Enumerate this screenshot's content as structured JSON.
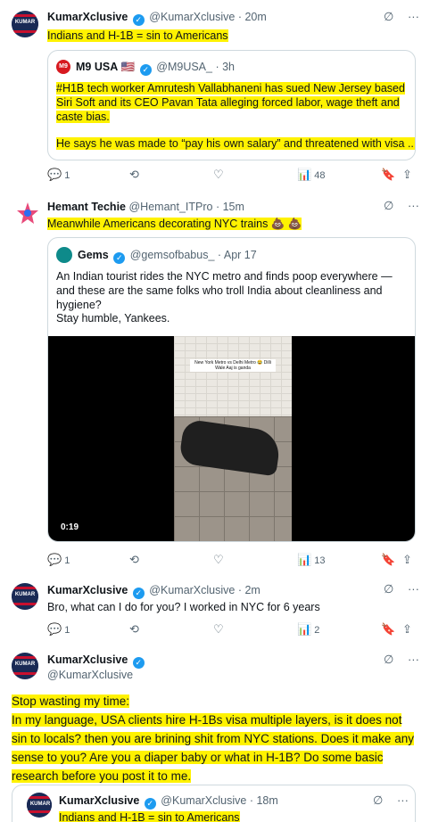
{
  "tweet1": {
    "avatar_text": "KUMAR",
    "name": "KumarXclusive",
    "handle": "@KumarXclusive",
    "time": "· 20m",
    "text": "Indians and H-1B = sin to Americans",
    "quote": {
      "avatar_text": "M9",
      "name": "M9 USA",
      "flag": "🇺🇸",
      "handle": "@M9USA_",
      "time": "· 3h",
      "text1": "#H1B tech worker Amrutesh Vallabhaneni has sued New Jersey based Siri Soft and its CEO Pavan Tata alleging forced labor, wage theft and caste bias.",
      "text2": "He says he was made to “pay his own salary” and threatened with visa ..."
    },
    "stats": {
      "replies": "1",
      "views": "48"
    }
  },
  "tweet2": {
    "name": "Hemant Techie",
    "handle": "@Hemant_ITPro",
    "time": "· 15m",
    "text": "Meanwhile Americans decorating NYC trains 💩 💩",
    "quote": {
      "name": "Gems",
      "handle": "@gemsofbabus_",
      "time": "· Apr 17",
      "text1": "An Indian tourist rides the NYC metro and finds poop everywhere — and these are the same folks who troll India about cleanliness and hygiene?",
      "text2": "Stay humble, Yankees.",
      "video_caption": "New York Metro vs Delhi Metro 😂 Dilli Wale Aaj is ganda",
      "video_duration": "0:19"
    },
    "stats": {
      "replies": "1",
      "views": "13"
    }
  },
  "tweet3": {
    "avatar_text": "KUMAR",
    "name": "KumarXclusive",
    "handle": "@KumarXclusive",
    "time": "· 2m",
    "text": "Bro, what can I do for you? I worked in NYC for 6 years",
    "stats": {
      "replies": "1",
      "views": "2"
    }
  },
  "tweet4": {
    "avatar_text": "KUMAR",
    "name": "KumarXclusive",
    "handle": "@KumarXclusive",
    "line1": "Stop wasting my time:",
    "line2": "In my language, USA clients hire H-1Bs visa multiple layers, is it does not sin to locals? then you are brining shit from NYC stations. Does it make any sense to you? Are you a diaper baby or what in H-1B? Do some basic research before you post it to me.",
    "quote": {
      "avatar_text": "KUMAR",
      "name": "KumarXclusive",
      "handle": "@KumarXclusive",
      "time": "· 18m",
      "text": "Indians and H-1B = sin to Americans"
    }
  },
  "icons": {
    "reply": "💬",
    "retweet": "⟲",
    "like": "♡",
    "views": "📊",
    "bookmark": "🔖",
    "share": "⇪",
    "grok": "∅",
    "more": "···",
    "verified": "✓"
  },
  "colors": {
    "highlight": "#fff200",
    "verified": "#1d9bf0",
    "muted": "#536471"
  }
}
